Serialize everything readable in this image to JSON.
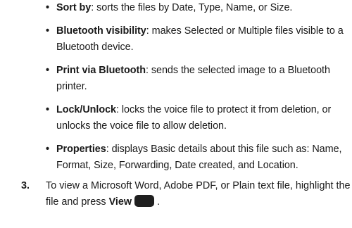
{
  "bullets": [
    {
      "term": "Sort by",
      "text": ": sorts the files by Date, Type, Name, or Size."
    },
    {
      "term": "Bluetooth visibility",
      "text": ": makes Selected or Multiple files visible to a Bluetooth device."
    },
    {
      "term": "Print via Bluetooth",
      "text": ": sends the selected image to a Bluetooth printer."
    },
    {
      "term": "Lock/Unlock",
      "text": ": locks the voice file to protect it from deletion, or unlocks the voice file to allow deletion."
    },
    {
      "term": "Properties",
      "text": ": displays Basic details about this file such as: Name, Format, Size, Forwarding, Date created, and Location."
    }
  ],
  "step": {
    "number": "3.",
    "text_before": "To view a Microsoft Word, Adobe PDF, or Plain text file, highlight the file and press ",
    "button_label": "View",
    "text_after": " ."
  },
  "icons": {
    "bullet": "bullet-dot-icon",
    "softkey": "softkey-icon"
  },
  "colors": {
    "text": "#1a1a1a",
    "softkey": "#1f1f1f"
  }
}
